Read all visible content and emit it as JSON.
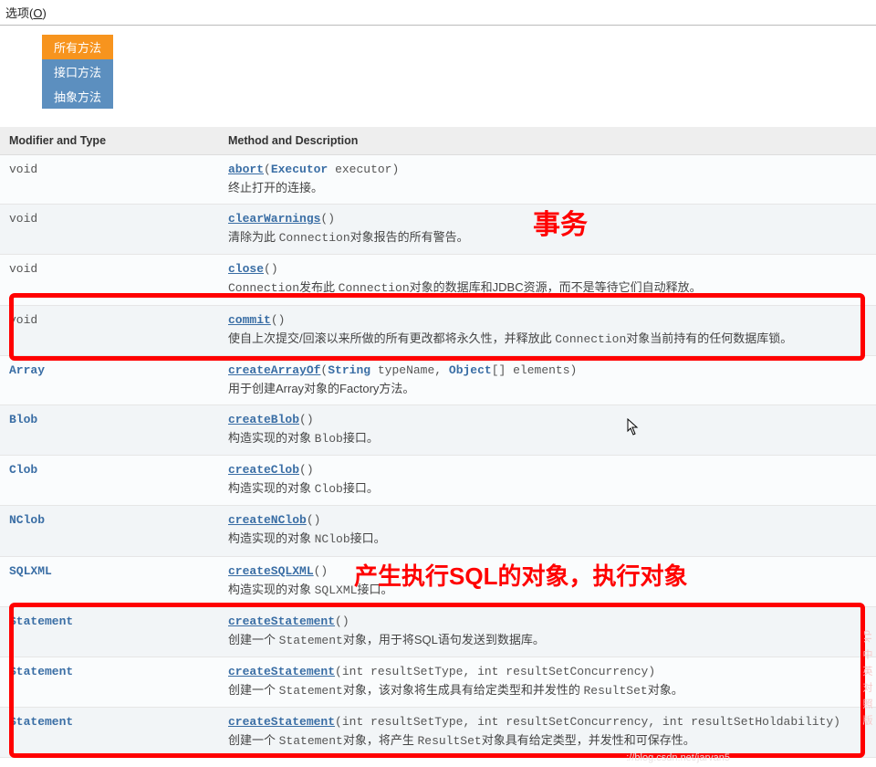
{
  "topbar_label": "选项(",
  "topbar_mnemonic": "O",
  "topbar_close": ")",
  "tabs": {
    "all": "所有方法",
    "interface": "接口方法",
    "abstract": "抽象方法"
  },
  "headers": {
    "modifier": "Modifier and Type",
    "method": "Method and Description"
  },
  "annotations": {
    "transaction": "事务",
    "exec_object": "产生执行SQL的对象，执行对象"
  },
  "sidemark": "dk 中 英 对 照 版",
  "bottommark": "://blog.csdn.net/jarvan5",
  "rows": [
    {
      "modifier_plain": "void",
      "method_name": "abort",
      "param_html": "(<span class='paramtype'>Executor</span> <span class='paramname'>executor</span>)",
      "desc_html": "终止打开的连接。"
    },
    {
      "modifier_plain": "void",
      "method_name": "clearWarnings",
      "param_html": "()",
      "desc_html": "清除为此 <code>Connection</code>对象报告的所有警告。"
    },
    {
      "modifier_plain": "void",
      "method_name": "close",
      "param_html": "()",
      "desc_html": "<code>Connection</code>发布此 <code>Connection</code>对象的数据库和JDBC资源，而不是等待它们自动释放。"
    },
    {
      "modifier_plain": "void",
      "method_name": "commit",
      "param_html": "()",
      "desc_html": "使自上次提交/回滚以来所做的所有更改都将永久性，并释放此 <code>Connection</code>对象当前持有的任何数据库锁。"
    },
    {
      "modifier_link": "Array",
      "method_name": "createArrayOf",
      "param_html": "(<span class='paramtype'>String</span> <span class='paramname'>typeName</span>, <span class='paramtype'>Object</span>[] <span class='paramname'>elements</span>)",
      "desc_html": "用于创建Array对象的Factory方法。"
    },
    {
      "modifier_link": "Blob",
      "method_name": "createBlob",
      "param_html": "()",
      "desc_html": "构造实现的对象 <code>Blob</code>接口。"
    },
    {
      "modifier_link": "Clob",
      "method_name": "createClob",
      "param_html": "()",
      "desc_html": "构造实现的对象 <code>Clob</code>接口。"
    },
    {
      "modifier_link": "NClob",
      "method_name": "createNClob",
      "param_html": "()",
      "desc_html": "构造实现的对象 <code>NClob</code>接口。"
    },
    {
      "modifier_link": "SQLXML",
      "method_name": "createSQLXML",
      "param_html": "()",
      "desc_html": "构造实现的对象 <code>SQLXML</code>接口。"
    },
    {
      "modifier_link": "Statement",
      "method_name": "createStatement",
      "param_html": "()",
      "desc_html": "创建一个 <code>Statement</code>对象，用于将SQL语句发送到数据库。"
    },
    {
      "modifier_link": "Statement",
      "method_name": "createStatement",
      "param_html": "(<span class='paramname'>int resultSetType</span>, <span class='paramname'>int resultSetConcurrency</span>)",
      "desc_html": "创建一个 <code>Statement</code>对象，该对象将生成具有给定类型和并发性的 <code>ResultSet</code>对象。"
    },
    {
      "modifier_link": "Statement",
      "method_name": "createStatement",
      "param_html": "(<span class='paramname'>int resultSetType</span>, <span class='paramname'>int resultSetConcurrency</span>, <span class='paramname'>int resultSetHoldability</span>)",
      "desc_html": "创建一个 <code>Statement</code>对象，将产生 <code>ResultSet</code>对象具有给定类型，并发性和可保存性。"
    }
  ]
}
